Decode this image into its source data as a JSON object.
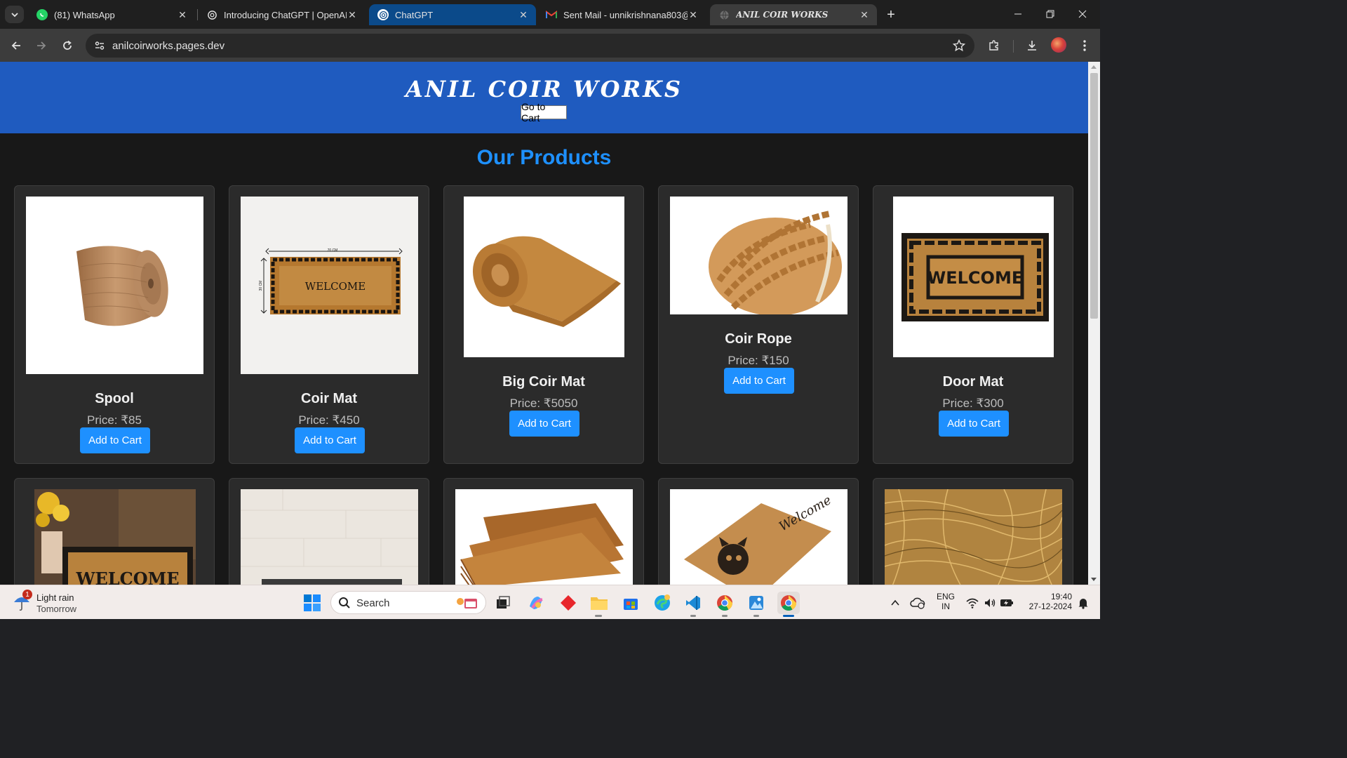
{
  "browser": {
    "tabs": [
      {
        "title": "(81) WhatsApp",
        "favicon": "whatsapp-icon"
      },
      {
        "title": "Introducing ChatGPT | OpenAI",
        "favicon": "openai-icon"
      },
      {
        "title": "ChatGPT",
        "favicon": "openai-icon"
      },
      {
        "title": "Sent Mail - unnikrishnana803@",
        "favicon": "gmail-icon"
      },
      {
        "title": "ANIL COIR WORKS",
        "favicon": "globe-icon"
      }
    ],
    "url": "anilcoirworks.pages.dev"
  },
  "site": {
    "title": "ANIL COIR WORKS",
    "cart_button": "Go to Cart",
    "section_title": "Our Products",
    "colors": {
      "header": "#1f5bbf",
      "accent": "#1e90ff",
      "background": "#181818",
      "card": "#2b2b2b"
    },
    "products": [
      {
        "name": "Spool",
        "price": "Price: ₹85",
        "button": "Add to Cart"
      },
      {
        "name": "Coir Mat",
        "price": "Price: ₹450",
        "button": "Add to Cart",
        "image_text": {
          "width": "70 CM",
          "height": "30 CM",
          "mat": "WELCOME"
        }
      },
      {
        "name": "Big Coir Mat",
        "price": "Price: ₹5050",
        "button": "Add to Cart"
      },
      {
        "name": "Coir Rope",
        "price": "Price: ₹150",
        "button": "Add to Cart"
      },
      {
        "name": "Door Mat",
        "price": "Price: ₹300",
        "button": "Add to Cart",
        "image_text": {
          "mat": "WELCOME"
        }
      }
    ],
    "row2_image_text": {
      "doormat": "WELCOME",
      "cat_mat": "Welcome"
    }
  },
  "taskbar": {
    "weather": {
      "line1": "Light rain",
      "line2": "Tomorrow",
      "badge": "1"
    },
    "search_label": "Search",
    "language": {
      "line1": "ENG",
      "line2": "IN"
    },
    "time": "19:40",
    "date": "27-12-2024"
  }
}
